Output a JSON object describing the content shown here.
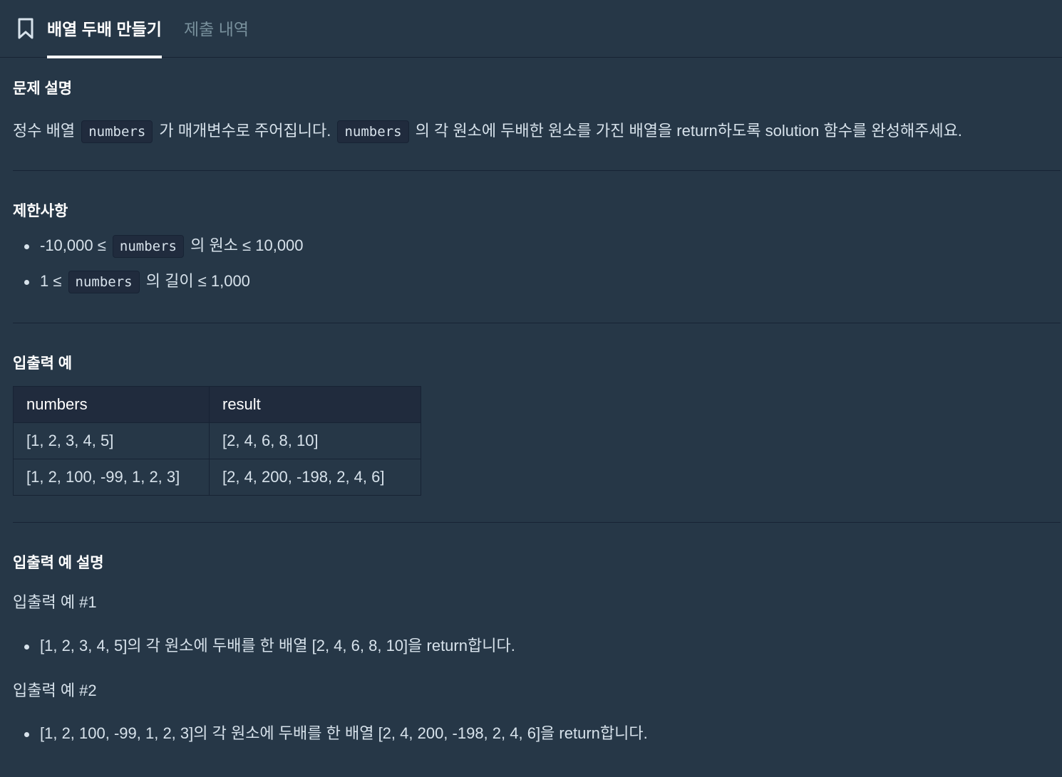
{
  "tabs": {
    "active": "배열 두배 만들기",
    "inactive": "제출 내역",
    "icon": "bookmark-icon"
  },
  "description": {
    "title": "문제 설명",
    "text_1": "정수 배열 ",
    "code_1": "numbers",
    "text_2": " 가 매개변수로 주어집니다. ",
    "code_2": "numbers",
    "text_3": " 의 각 원소에 두배한 원소를 가진 배열을 return하도록 solution 함수를 완성해주세요."
  },
  "constraints": {
    "title": "제한사항",
    "items": [
      {
        "before": "-10,000 ≤ ",
        "code": "numbers",
        "after": " 의 원소 ≤ 10,000"
      },
      {
        "before": "1 ≤ ",
        "code": "numbers",
        "after": " 의 길이 ≤ 1,000"
      }
    ]
  },
  "examples": {
    "title": "입출력 예",
    "headers": [
      "numbers",
      "result"
    ],
    "rows": [
      [
        "[1, 2, 3, 4, 5]",
        "[2, 4, 6, 8, 10]"
      ],
      [
        "[1, 2, 100, -99, 1, 2, 3]",
        "[2, 4, 200, -198, 2, 4, 6]"
      ]
    ]
  },
  "explanation": {
    "title": "입출력 예 설명",
    "ex1_label": "입출력 예 #1",
    "ex1_item": "[1, 2, 3, 4, 5]의 각 원소에 두배를 한 배열 [2, 4, 6, 8, 10]을 return합니다.",
    "ex2_label": "입출력 예 #2",
    "ex2_item": "[1, 2, 100, -99, 1, 2, 3]의 각 원소에 두배를 한 배열 [2, 4, 200, -198, 2, 4, 6]을 return합니다."
  }
}
